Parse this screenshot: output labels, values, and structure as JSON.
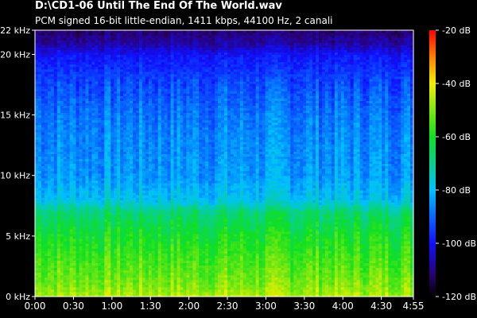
{
  "chart_data": {
    "type": "heatmap",
    "title": "D:\\CD1-06 Until The End Of The World.wav",
    "subtitle": "PCM signed 16-bit little-endian, 1411 kbps, 44100 Hz, 2 canali",
    "x_ticks": [
      {
        "value": 0,
        "label": "0:00"
      },
      {
        "value": 30,
        "label": "0:30"
      },
      {
        "value": 60,
        "label": "1:00"
      },
      {
        "value": 90,
        "label": "1:30"
      },
      {
        "value": 120,
        "label": "2:00"
      },
      {
        "value": 150,
        "label": "2:30"
      },
      {
        "value": 180,
        "label": "3:00"
      },
      {
        "value": 210,
        "label": "3:30"
      },
      {
        "value": 240,
        "label": "4:00"
      },
      {
        "value": 270,
        "label": "4:30"
      },
      {
        "value": 295,
        "label": "4:55"
      }
    ],
    "y_ticks": [
      {
        "value": 0,
        "label": "0 kHz"
      },
      {
        "value": 5,
        "label": "5 kHz"
      },
      {
        "value": 10,
        "label": "10 kHz"
      },
      {
        "value": 15,
        "label": "15 kHz"
      },
      {
        "value": 20,
        "label": "20 kHz"
      },
      {
        "value": 22,
        "label": "22 kHz"
      }
    ],
    "xlim": [
      0,
      295
    ],
    "ylim": [
      0,
      22
    ],
    "colorbar": {
      "range": [
        -120,
        -20
      ],
      "ticks": [
        {
          "value": -20,
          "label": "-20 dB"
        },
        {
          "value": -40,
          "label": "-40 dB"
        },
        {
          "value": -60,
          "label": "-60 dB"
        },
        {
          "value": -80,
          "label": "-80 dB"
        },
        {
          "value": -100,
          "label": "-100 dB"
        },
        {
          "value": -120,
          "label": "-120 dB"
        }
      ]
    },
    "level_profile": [
      {
        "freq_khz": 0,
        "db": -45
      },
      {
        "freq_khz": 1,
        "db": -50
      },
      {
        "freq_khz": 3,
        "db": -55
      },
      {
        "freq_khz": 5,
        "db": -60
      },
      {
        "freq_khz": 7,
        "db": -67
      },
      {
        "freq_khz": 8,
        "db": -78
      },
      {
        "freq_khz": 10,
        "db": -84
      },
      {
        "freq_khz": 13,
        "db": -86
      },
      {
        "freq_khz": 15,
        "db": -88
      },
      {
        "freq_khz": 18,
        "db": -94
      },
      {
        "freq_khz": 20,
        "db": -100
      },
      {
        "freq_khz": 21,
        "db": -108
      },
      {
        "freq_khz": 22,
        "db": -112
      }
    ]
  }
}
